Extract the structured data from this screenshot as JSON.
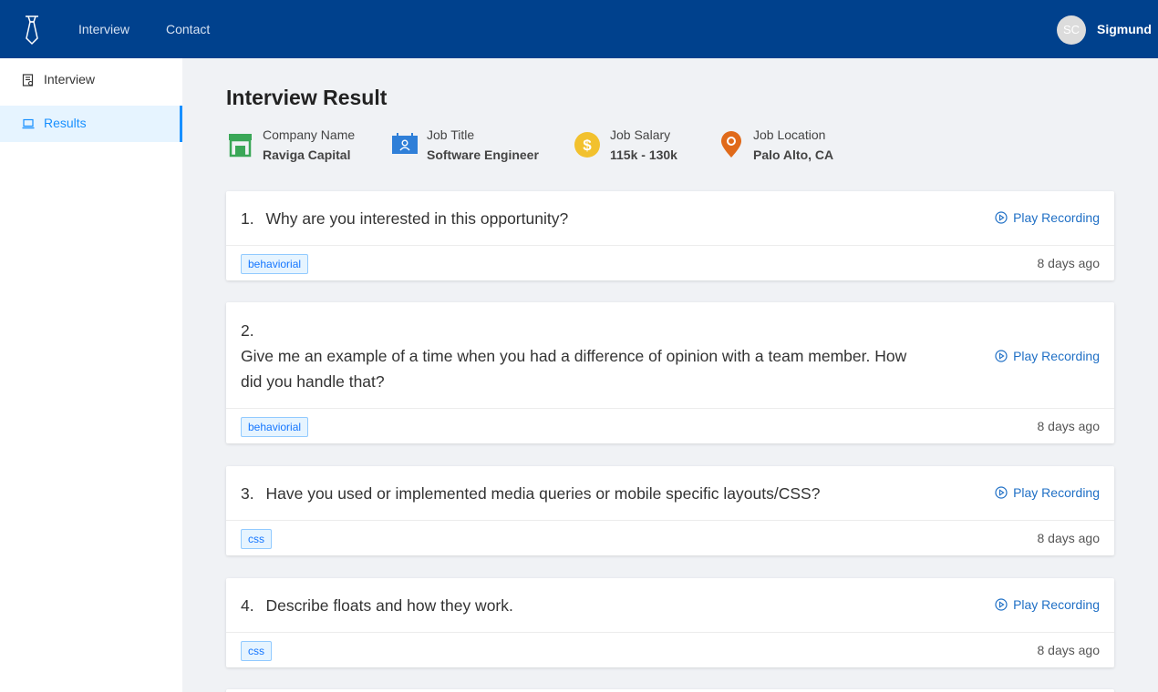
{
  "topbar": {
    "nav": [
      "Interview",
      "Contact"
    ],
    "avatar_initials": "SC",
    "username": "Sigmund"
  },
  "sidebar": {
    "items": [
      {
        "label": "Interview",
        "icon": "interview-form-icon",
        "active": false
      },
      {
        "label": "Results",
        "icon": "laptop-icon",
        "active": true
      }
    ]
  },
  "main": {
    "title": "Interview Result",
    "meta": [
      {
        "label": "Company Name",
        "value": "Raviga Capital",
        "icon": "shop-icon",
        "color": "#3aa757"
      },
      {
        "label": "Job Title",
        "value": "Software Engineer",
        "icon": "calendar-user-icon",
        "color": "#2f7fd8"
      },
      {
        "label": "Job Salary",
        "value": "115k - 130k",
        "icon": "dollar-coin-icon",
        "color": "#f2c12e"
      },
      {
        "label": "Job Location",
        "value": "Palo Alto, CA",
        "icon": "map-pin-icon",
        "color": "#e06a1a"
      }
    ],
    "questions": [
      {
        "num": "1.",
        "text": "Why are you interested in this opportunity?",
        "tag": "behaviorial",
        "time": "8 days ago",
        "play": "Play Recording"
      },
      {
        "num": "2.",
        "text_lines": [
          "Give me an example of a time when you had a difference of opinion with a team member. How",
          "did you handle that?"
        ],
        "tag": "behaviorial",
        "time": "8 days ago",
        "play": "Play Recording"
      },
      {
        "num": "3.",
        "text": "Have you used or implemented media queries or mobile specific layouts/CSS?",
        "tag": "css",
        "time": "8 days ago",
        "play": "Play Recording"
      },
      {
        "num": "4.",
        "text": "Describe floats and how they work.",
        "tag": "css",
        "time": "8 days ago",
        "play": "Play Recording"
      }
    ]
  },
  "colors": {
    "header": "#00418d",
    "accent": "#1890ff",
    "link": "#1f6fc5"
  }
}
